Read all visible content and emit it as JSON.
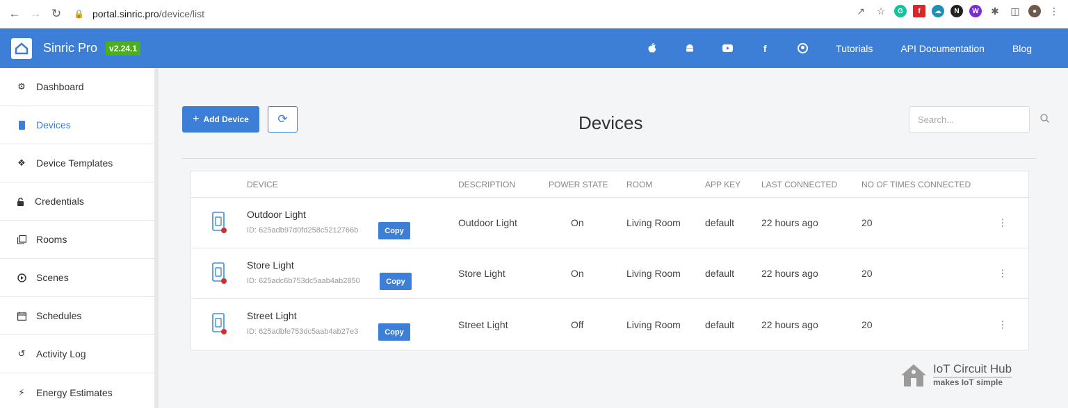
{
  "browser": {
    "url_host": "portal.sinric.pro",
    "url_path": "/device/list"
  },
  "header": {
    "brand": "Sinric Pro",
    "version": "v2.24.1",
    "links": [
      "Tutorials",
      "API Documentation",
      "Blog"
    ],
    "social_icons": [
      "apple-icon",
      "android-icon",
      "youtube-icon",
      "facebook-icon",
      "github-icon"
    ]
  },
  "sidebar": {
    "items": [
      {
        "label": "Dashboard",
        "icon": "dashboard-icon"
      },
      {
        "label": "Devices",
        "icon": "device-icon"
      },
      {
        "label": "Device Templates",
        "icon": "templates-icon"
      },
      {
        "label": "Credentials",
        "icon": "lock-icon"
      },
      {
        "label": "Rooms",
        "icon": "rooms-icon"
      },
      {
        "label": "Scenes",
        "icon": "play-icon"
      },
      {
        "label": "Schedules",
        "icon": "calendar-icon"
      },
      {
        "label": "Activity Log",
        "icon": "history-icon"
      },
      {
        "label": "Energy Estimates",
        "icon": "bolt-icon"
      }
    ],
    "active": "Devices"
  },
  "main": {
    "title": "Devices",
    "add_button": "Add Device",
    "search_placeholder": "Search...",
    "columns": [
      "DEVICE",
      "DESCRIPTION",
      "POWER STATE",
      "ROOM",
      "APP KEY",
      "LAST CONNECTED",
      "NO OF TIMES CONNECTED"
    ],
    "copy_label": "Copy",
    "rows": [
      {
        "name": "Outdoor Light",
        "id": "ID: 625adb97d0fd258c5212766b",
        "description": "Outdoor Light",
        "power": "On",
        "room": "Living Room",
        "app_key": "default",
        "last_connected": "22 hours ago",
        "count": "20"
      },
      {
        "name": "Store Light",
        "id": "ID: 625adc6b753dc5aab4ab2850",
        "description": "Store Light",
        "power": "On",
        "room": "Living Room",
        "app_key": "default",
        "last_connected": "22 hours ago",
        "count": "20"
      },
      {
        "name": "Street Light",
        "id": "ID: 625adbfe753dc5aab4ab27e3",
        "description": "Street Light",
        "power": "Off",
        "room": "Living Room",
        "app_key": "default",
        "last_connected": "22 hours ago",
        "count": "20"
      }
    ]
  },
  "watermark": {
    "title": "IoT Circuit Hub",
    "subtitle": "makes IoT simple"
  },
  "colors": {
    "accent": "#3d7ed6",
    "version_badge": "#4caf20",
    "offline_dot": "#d32f2f"
  }
}
